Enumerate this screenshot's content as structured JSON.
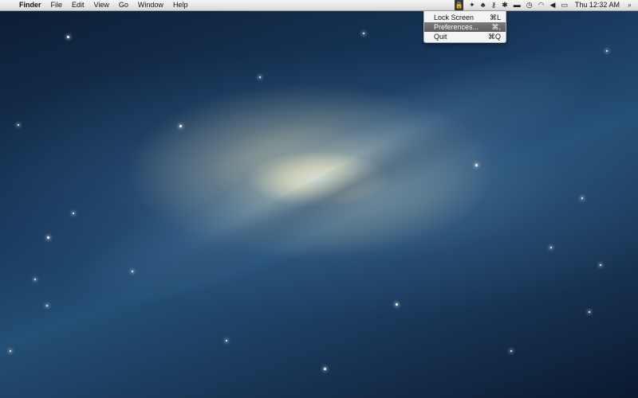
{
  "menubar": {
    "apple_glyph": "",
    "app_name": "Finder",
    "menus": [
      "File",
      "Edit",
      "View",
      "Go",
      "Window",
      "Help"
    ],
    "status_icons": [
      "padlock-icon",
      "dropbox-icon",
      "evernote-icon",
      "keychain-icon",
      "bluetooth-icon",
      "battery-meter-icon",
      "time-machine-icon",
      "wifi-icon",
      "volume-icon",
      "battery-icon",
      "spotlight-icon"
    ],
    "clock": "Thu 12:32 AM"
  },
  "dropdown": {
    "items": [
      {
        "label": "Lock Screen",
        "shortcut": "⌘L",
        "highlighted": false
      },
      {
        "label": "Preferences...",
        "shortcut": "⌘,",
        "highlighted": true
      },
      {
        "label": "Quit",
        "shortcut": "⌘Q",
        "highlighted": false
      }
    ]
  },
  "colors": {
    "menubar_bg": "#e6e6e6",
    "highlight": "#6e6e6e",
    "space_dark": "#0c1d33",
    "space_mid": "#244e74",
    "galaxy_core": "#fff4d2"
  }
}
